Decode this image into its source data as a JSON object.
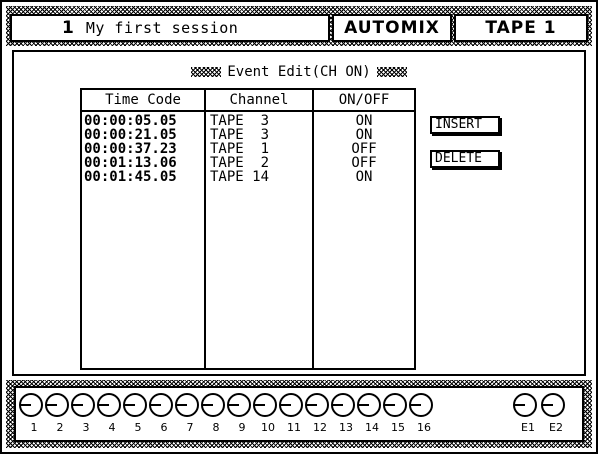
{
  "header": {
    "session_number": "1",
    "session_name": "My first session",
    "mode": "AUTOMIX",
    "source": "TAPE 1"
  },
  "panel": {
    "title": "Event Edit(CH ON)",
    "columns": {
      "time_code": "Time Code",
      "channel": "Channel",
      "on_off": "ON/OFF"
    },
    "events": [
      {
        "time_code": "00:00:05.05",
        "channel": "TAPE  3",
        "state": "ON"
      },
      {
        "time_code": "00:00:21.05",
        "channel": "TAPE  3",
        "state": "ON"
      },
      {
        "time_code": "00:00:37.23",
        "channel": "TAPE  1",
        "state": "OFF"
      },
      {
        "time_code": "00:01:13.06",
        "channel": "TAPE  2",
        "state": "OFF"
      },
      {
        "time_code": "00:01:45.05",
        "channel": "TAPE 14",
        "state": "ON"
      }
    ],
    "insert_label": "INSERT",
    "delete_label": "DELETE"
  },
  "strip": {
    "channels": [
      "1",
      "2",
      "3",
      "4",
      "5",
      "6",
      "7",
      "8",
      "9",
      "10",
      "11",
      "12",
      "13",
      "14",
      "15",
      "16"
    ],
    "effects": [
      "E1",
      "E2"
    ]
  }
}
